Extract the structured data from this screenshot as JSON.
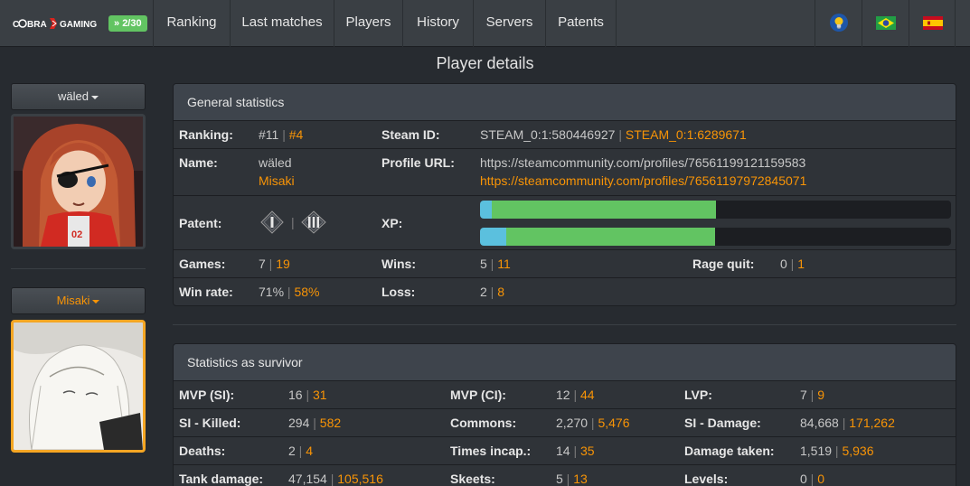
{
  "nav": {
    "logo": "COBRA GAMING",
    "counter": "2/30",
    "items": [
      "Ranking",
      "Last matches",
      "Players",
      "History",
      "Servers",
      "Patents"
    ]
  },
  "page_title": "Player details",
  "sidebar": {
    "player1": "wäled",
    "player2": "Misaki"
  },
  "general": {
    "title": "General statistics",
    "ranking_label": "Ranking:",
    "ranking_p1": "#11",
    "ranking_p2": "#4",
    "steamid_label": "Steam ID:",
    "steamid_p1": "STEAM_0:1:580446927",
    "steamid_p2": "STEAM_0:1:6289671",
    "name_label": "Name:",
    "name_p1": "wäled",
    "name_p2": "Misaki",
    "profile_label": "Profile URL:",
    "profile_p1": "https://steamcommunity.com/profiles/76561199121159583",
    "profile_p2": "https://steamcommunity.com/profiles/76561197972845071",
    "patent_label": "Patent:",
    "xp_label": "XP:",
    "xp_p1": {
      "blue": 0.024,
      "green": 0.5
    },
    "xp_p2": {
      "blue": 0.056,
      "green": 0.5
    },
    "games_label": "Games:",
    "games_p1": "7",
    "games_p2": "19",
    "wins_label": "Wins:",
    "wins_p1": "5",
    "wins_p2": "11",
    "ragequit_label": "Rage quit:",
    "ragequit_p1": "0",
    "ragequit_p2": "1",
    "winrate_label": "Win rate:",
    "winrate_p1": "71%",
    "winrate_p2": "58%",
    "loss_label": "Loss:",
    "loss_p1": "2",
    "loss_p2": "8"
  },
  "survivor": {
    "title": "Statistics as survivor",
    "rows": [
      [
        {
          "label": "MVP (SI):",
          "p1": "16",
          "p2": "31"
        },
        {
          "label": "MVP (CI):",
          "p1": "12",
          "p2": "44"
        },
        {
          "label": "LVP:",
          "p1": "7",
          "p2": "9"
        }
      ],
      [
        {
          "label": "SI - Killed:",
          "p1": "294",
          "p2": "582"
        },
        {
          "label": "Commons:",
          "p1": "2,270",
          "p2": "5,476"
        },
        {
          "label": "SI - Damage:",
          "p1": "84,668",
          "p2": "171,262"
        }
      ],
      [
        {
          "label": "Deaths:",
          "p1": "2",
          "p2": "4"
        },
        {
          "label": "Times incap.:",
          "p1": "14",
          "p2": "35"
        },
        {
          "label": "Damage taken:",
          "p1": "1,519",
          "p2": "5,936"
        }
      ],
      [
        {
          "label": "Tank damage:",
          "p1": "47,154",
          "p2": "105,516"
        },
        {
          "label": "Skeets:",
          "p1": "5",
          "p2": "13"
        },
        {
          "label": "Levels:",
          "p1": "0",
          "p2": "0"
        }
      ]
    ]
  },
  "colors": {
    "accent": "#f89406",
    "success": "#62c462",
    "info": "#5bc0de"
  }
}
